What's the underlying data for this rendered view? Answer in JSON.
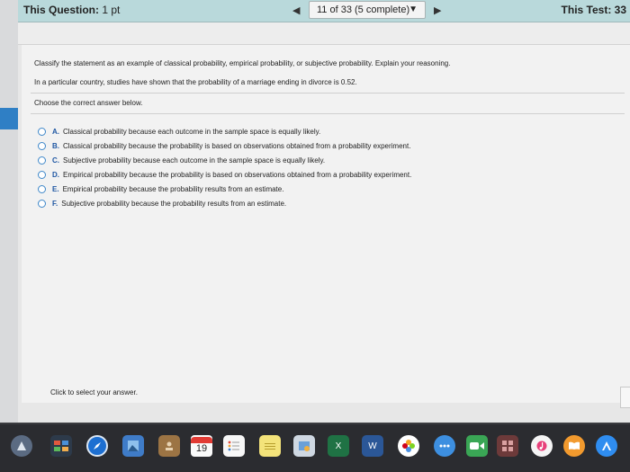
{
  "header": {
    "question_label": "This Question:",
    "question_points": "1 pt",
    "nav_prev_glyph": "◀",
    "nav_position": "11 of 33 (5 complete)",
    "nav_caret_glyph": "▼",
    "nav_next_glyph": "▶",
    "test_score": "This Test: 33"
  },
  "question": {
    "prompt": "Classify the statement as an example of classical probability, empirical probability, or subjective probability. Explain your reasoning.",
    "scenario": "In a particular country, studies have shown that the probability of a marriage ending in divorce is 0.52.",
    "instruction": "Choose the correct answer below.",
    "options": [
      {
        "letter": "A.",
        "text": "Classical probability because each outcome in the sample space is equally likely."
      },
      {
        "letter": "B.",
        "text": "Classical probability because the probability is based on observations obtained from a probability experiment."
      },
      {
        "letter": "C.",
        "text": "Subjective probability because each outcome in the sample space is equally likely."
      },
      {
        "letter": "D.",
        "text": "Empirical probability because the probability is based on observations obtained from a probability experiment."
      },
      {
        "letter": "E.",
        "text": "Empirical probability because the probability results from an estimate."
      },
      {
        "letter": "F.",
        "text": "Subjective probability because the probability results from an estimate."
      }
    ],
    "footer_hint": "Click to select your answer."
  },
  "dock": {
    "calendar_day": "19",
    "excel_letter": "X",
    "word_letter": "W",
    "icons": [
      "launchpad-icon",
      "mission-control-icon",
      "safari-icon",
      "preview-icon",
      "contacts-icon",
      "calendar-icon",
      "reminders-icon",
      "notes-icon",
      "photos-viewer-icon",
      "excel-icon",
      "word-icon",
      "photos-icon",
      "messages-icon",
      "facetime-icon",
      "photo-booth-icon",
      "itunes-icon",
      "ibooks-icon",
      "app-store-icon"
    ]
  },
  "colors": {
    "topbar": "#b9d9db",
    "accent_blue": "#2f7fc5",
    "option_letter": "#1f57a3"
  }
}
